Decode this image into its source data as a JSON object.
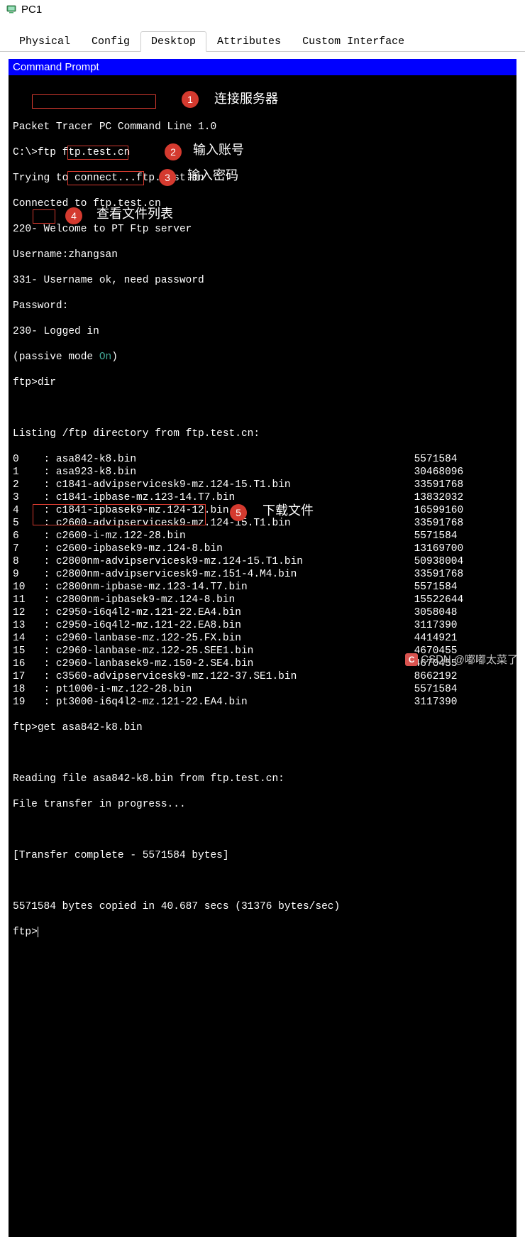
{
  "window": {
    "title": "PC1"
  },
  "tabs": [
    {
      "label": "Physical"
    },
    {
      "label": "Config"
    },
    {
      "label": "Desktop"
    },
    {
      "label": "Attributes"
    },
    {
      "label": "Custom Interface"
    }
  ],
  "panel_title": "Command Prompt",
  "terminal": {
    "intro": "Packet Tracer PC Command Line 1.0",
    "prompt1": "C:\\>",
    "cmd1": "ftp ftp.test.cn",
    "line_trying": "Trying to connect...ftp.test.cn",
    "line_connected": "Connected to ftp.test.cn",
    "line_welcome": "220- Welcome to PT Ftp server",
    "username_prompt": "Username:",
    "username_value": "zhangsan",
    "line_userok": "331- Username ok, need password",
    "password_prompt": "Password:",
    "line_logged": "230- Logged in",
    "passive_pre": "(passive mode ",
    "passive_on": "On",
    "passive_post": ")",
    "prompt_ftp": "ftp>",
    "cmd_dir": "dir",
    "blank": " ",
    "listing_header": "Listing /ftp directory from ftp.test.cn:",
    "files": [
      {
        "idx": "0 ",
        "name": "asa842-k8.bin",
        "size": "5571584"
      },
      {
        "idx": "1 ",
        "name": "asa923-k8.bin",
        "size": "30468096"
      },
      {
        "idx": "2 ",
        "name": "c1841-advipservicesk9-mz.124-15.T1.bin",
        "size": "33591768"
      },
      {
        "idx": "3 ",
        "name": "c1841-ipbase-mz.123-14.T7.bin",
        "size": "13832032"
      },
      {
        "idx": "4 ",
        "name": "c1841-ipbasek9-mz.124-12.bin",
        "size": "16599160"
      },
      {
        "idx": "5 ",
        "name": "c2600-advipservicesk9-mz.124-15.T1.bin",
        "size": "33591768"
      },
      {
        "idx": "6 ",
        "name": "c2600-i-mz.122-28.bin",
        "size": "5571584"
      },
      {
        "idx": "7 ",
        "name": "c2600-ipbasek9-mz.124-8.bin",
        "size": "13169700"
      },
      {
        "idx": "8 ",
        "name": "c2800nm-advipservicesk9-mz.124-15.T1.bin",
        "size": "50938004"
      },
      {
        "idx": "9 ",
        "name": "c2800nm-advipservicesk9-mz.151-4.M4.bin",
        "size": "33591768"
      },
      {
        "idx": "10",
        "name": "c2800nm-ipbase-mz.123-14.T7.bin",
        "size": "5571584"
      },
      {
        "idx": "11",
        "name": "c2800nm-ipbasek9-mz.124-8.bin",
        "size": "15522644"
      },
      {
        "idx": "12",
        "name": "c2950-i6q4l2-mz.121-22.EA4.bin",
        "size": "3058048"
      },
      {
        "idx": "13",
        "name": "c2950-i6q4l2-mz.121-22.EA8.bin",
        "size": "3117390"
      },
      {
        "idx": "14",
        "name": "c2960-lanbase-mz.122-25.FX.bin",
        "size": "4414921"
      },
      {
        "idx": "15",
        "name": "c2960-lanbase-mz.122-25.SEE1.bin",
        "size": "4670455"
      },
      {
        "idx": "16",
        "name": "c2960-lanbasek9-mz.150-2.SE4.bin",
        "size": "4670455"
      },
      {
        "idx": "17",
        "name": "c3560-advipservicesk9-mz.122-37.SE1.bin",
        "size": "8662192"
      },
      {
        "idx": "18",
        "name": "pt1000-i-mz.122-28.bin",
        "size": "5571584"
      },
      {
        "idx": "19",
        "name": "pt3000-i6q4l2-mz.121-22.EA4.bin",
        "size": "3117390"
      }
    ],
    "cmd_get": "get asa842-k8.bin",
    "line_reading": "Reading file asa842-k8.bin from ftp.test.cn:",
    "line_progress": "File transfer in progress...",
    "line_transfer": "[Transfer complete - 5571584 bytes]",
    "line_copied": "5571584 bytes copied in 40.687 secs (31376 bytes/sec)"
  },
  "annotations": [
    {
      "num": "1",
      "label": "连接服务器"
    },
    {
      "num": "2",
      "label": "输入账号"
    },
    {
      "num": "3",
      "label": "输入密码"
    },
    {
      "num": "4",
      "label": "查看文件列表"
    },
    {
      "num": "5",
      "label": "下载文件"
    }
  ],
  "watermark": {
    "site": "CSDN",
    "user": "@嘟嘟太菜了"
  }
}
